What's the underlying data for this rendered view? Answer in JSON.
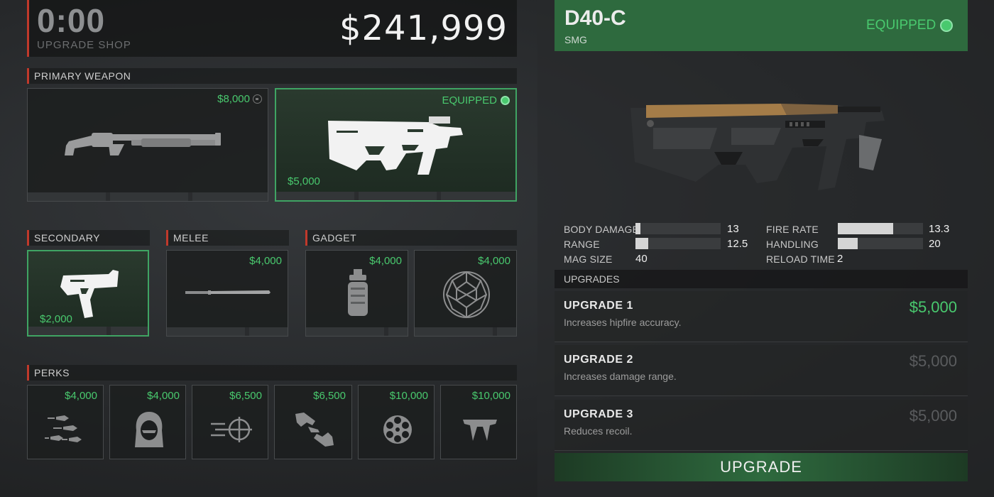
{
  "header": {
    "timer": "0:00",
    "shop_label": "UPGRADE SHOP",
    "money": "$241,999"
  },
  "sections": {
    "primary": "PRIMARY WEAPON",
    "secondary": "SECONDARY",
    "melee": "MELEE",
    "gadget": "GADGET",
    "perks": "PERKS"
  },
  "primary": {
    "shotgun_price": "$8,000",
    "smg_equipped_label": "EQUIPPED",
    "smg_price": "$5,000"
  },
  "secondary": {
    "price": "$2,000"
  },
  "melee": {
    "price": "$4,000"
  },
  "gadgets": [
    {
      "price": "$4,000",
      "icon": "grenade-icon"
    },
    {
      "price": "$4,000",
      "icon": "geodesic-dome-icon"
    }
  ],
  "perks": [
    {
      "price": "$4,000",
      "icon": "speed-bullets-icon"
    },
    {
      "price": "$4,000",
      "icon": "hooded-figure-icon"
    },
    {
      "price": "$6,500",
      "icon": "crosshair-dash-icon"
    },
    {
      "price": "$6,500",
      "icon": "hand-exchange-icon"
    },
    {
      "price": "$10,000",
      "icon": "revolver-cylinder-icon"
    },
    {
      "price": "$10,000",
      "icon": "fangs-icon"
    }
  ],
  "weapon": {
    "name": "D40-C",
    "class": "SMG",
    "equipped_label": "EQUIPPED",
    "stats": {
      "body_damage_label": "BODY DAMAGE",
      "body_damage": "13",
      "body_damage_fill": 0.06,
      "range_label": "RANGE",
      "range": "12.5",
      "range_fill": 0.15,
      "mag_size_label": "MAG SIZE",
      "mag_size": "40",
      "fire_rate_label": "FIRE RATE",
      "fire_rate": "13.3",
      "fire_rate_fill": 0.65,
      "handling_label": "HANDLING",
      "handling": "20",
      "handling_fill": 0.23,
      "reload_time_label": "RELOAD TIME",
      "reload_time": "2"
    }
  },
  "upgrades": {
    "header": "UPGRADES",
    "items": [
      {
        "title": "UPGRADE 1",
        "desc": "Increases hipfire accuracy.",
        "price": "$5,000"
      },
      {
        "title": "UPGRADE 2",
        "desc": "Increases damage range.",
        "price": "$5,000"
      },
      {
        "title": "UPGRADE 3",
        "desc": "Reduces recoil.",
        "price": "$5,000"
      }
    ],
    "button": "UPGRADE"
  },
  "colors": {
    "accent_green": "#49c96e",
    "accent_red": "#c0392b"
  }
}
